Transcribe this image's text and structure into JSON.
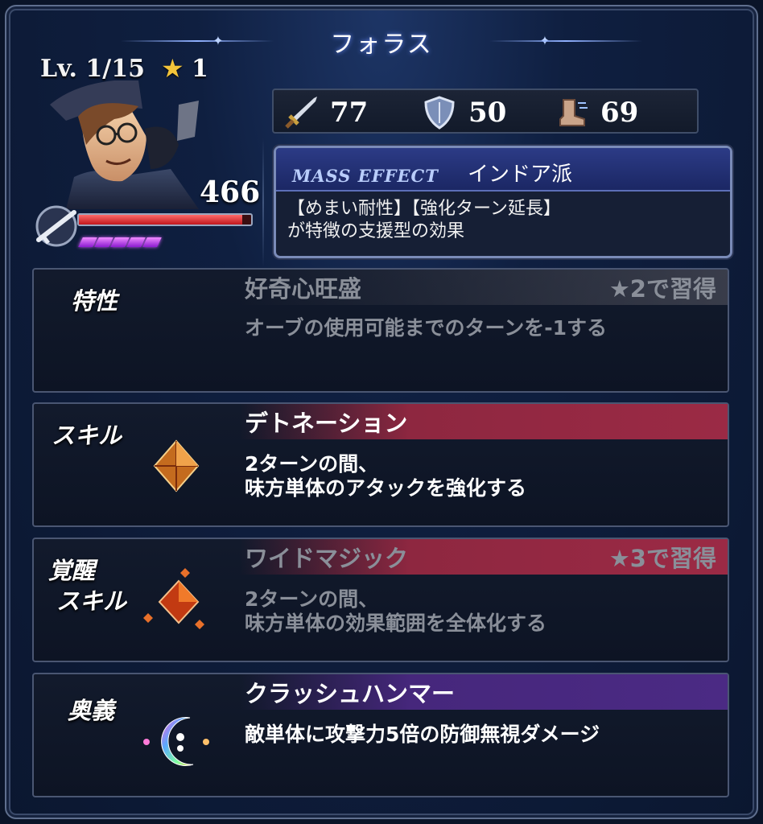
{
  "header": {
    "character_name": "フォラス",
    "level_label": "Lv. 1/15",
    "star_icon": "star-icon",
    "rank": "1"
  },
  "unit": {
    "hp": "466",
    "hp_fill": 0.95,
    "ap_pips": 5
  },
  "stats": {
    "attack": "77",
    "defense": "50",
    "speed": "69"
  },
  "mass_effect": {
    "tag": "MASS EFFECT",
    "name": "インドア派",
    "desc_line1": "【めまい耐性】【強化ターン延長】",
    "desc_line2": "が特徴の支援型の効果"
  },
  "trait": {
    "label": "特性",
    "name": "好奇心旺盛",
    "requirement": "★2で習得",
    "desc": "オーブの使用可能までのターンを-1する",
    "locked": true
  },
  "skill": {
    "label": "スキル",
    "name": "デトネーション",
    "desc_line1": "2ターンの間、",
    "desc_line2": "味方単体のアタックを強化する",
    "accent": "#9b2a45"
  },
  "awakened_skill": {
    "label_line1": "覚醒",
    "label_line2": "スキル",
    "name": "ワイドマジック",
    "requirement": "★3で習得",
    "desc_line1": "2ターンの間、",
    "desc_line2": "味方単体の効果範囲を全体化する",
    "locked": true,
    "accent": "#9b2a45"
  },
  "secret_art": {
    "label": "奥義",
    "name": "クラッシュハンマー",
    "desc": "敵単体に攻撃力5倍の防御無視ダメージ",
    "accent": "#4b2a84"
  }
}
